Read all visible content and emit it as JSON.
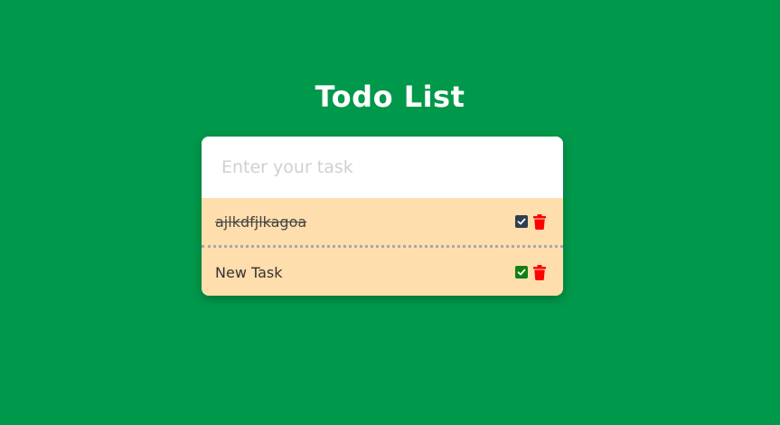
{
  "header": {
    "title": "Todo List"
  },
  "input": {
    "placeholder": "Enter your task",
    "value": ""
  },
  "tasks": [
    {
      "text": "ajlkdfjlkagoa",
      "completed": true,
      "check_color": "#2f3e4e",
      "check_icon": "check-square-icon",
      "delete_icon": "trash-icon"
    },
    {
      "text": "New Task",
      "completed": false,
      "check_color": "#108010",
      "check_icon": "check-square-icon",
      "delete_icon": "trash-icon"
    }
  ],
  "colors": {
    "background": "#00984a",
    "card": "#ffdead",
    "delete": "#ff0000"
  }
}
